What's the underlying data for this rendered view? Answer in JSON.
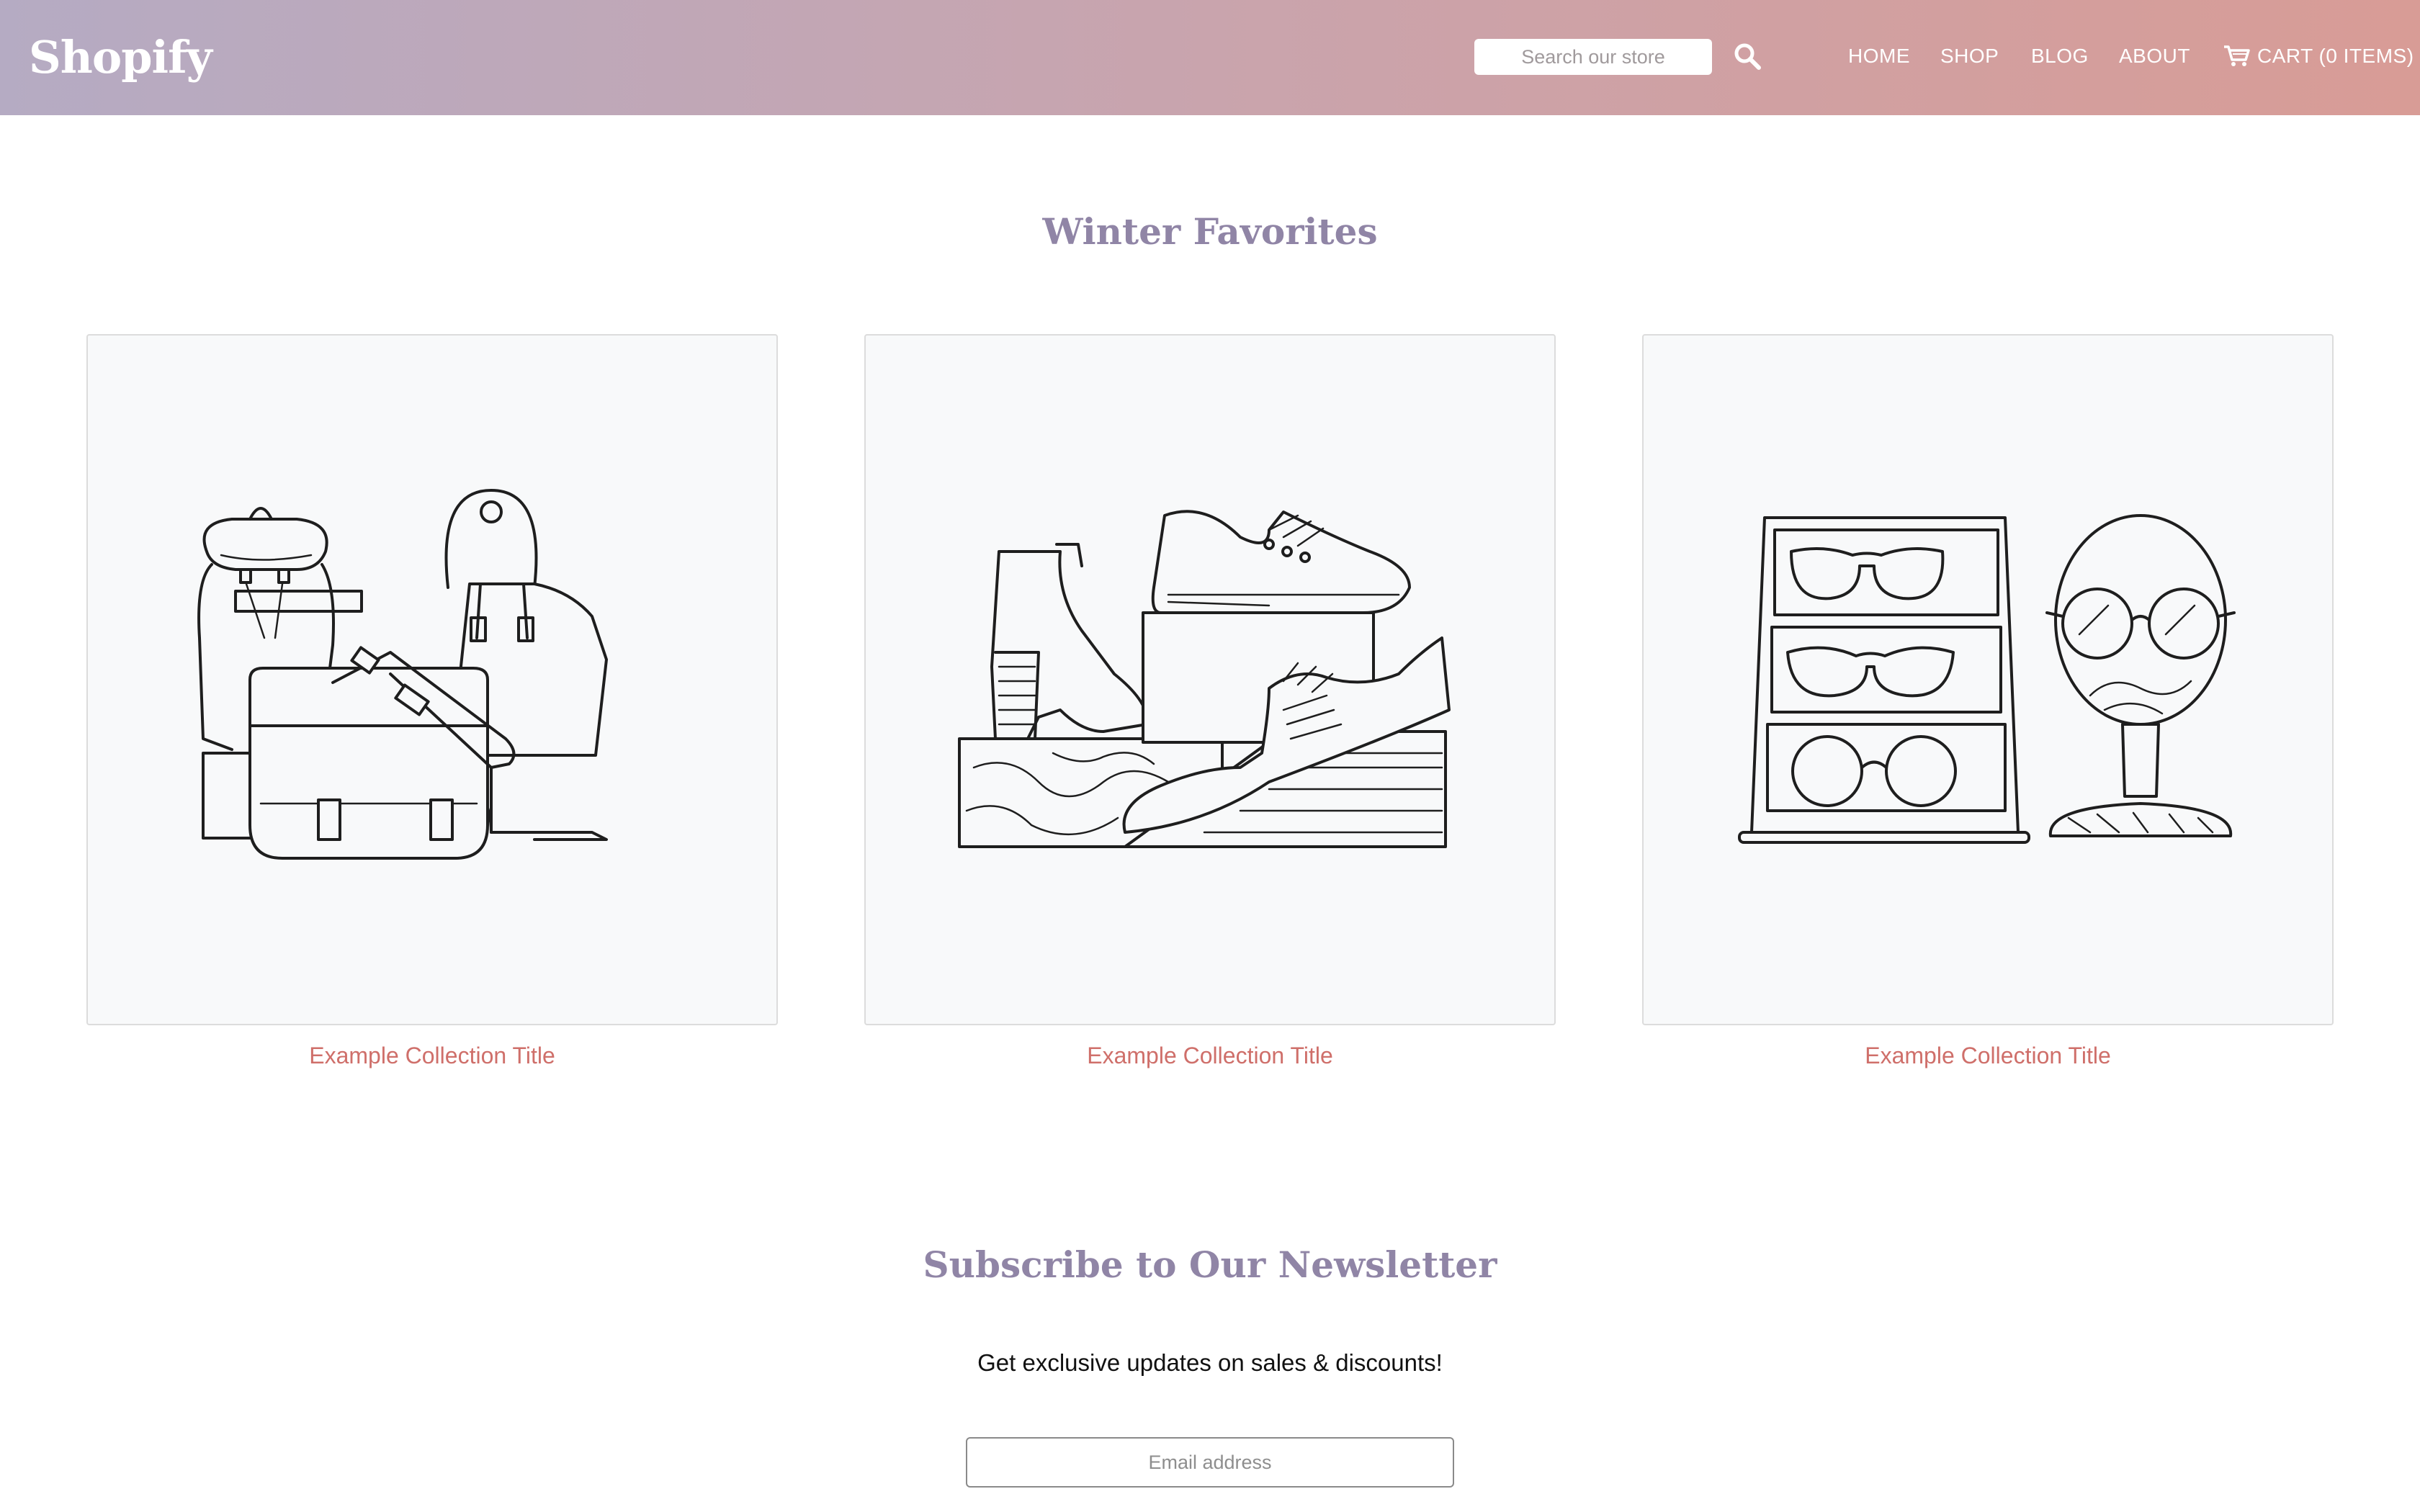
{
  "header": {
    "logo": "Shopify",
    "search_placeholder": "Search our store",
    "nav": [
      {
        "label": "HOME"
      },
      {
        "label": "SHOP"
      },
      {
        "label": "BLOG"
      },
      {
        "label": "ABOUT"
      }
    ],
    "cart_label": "CART (0 ITEMS)",
    "icons": {
      "search": "search-icon",
      "cart": "cart-icon"
    }
  },
  "collections": {
    "title": "Winter Favorites",
    "items": [
      {
        "title": "Example Collection Title",
        "image": "bags-illustration"
      },
      {
        "title": "Example Collection Title",
        "image": "shoes-illustration"
      },
      {
        "title": "Example Collection Title",
        "image": "glasses-illustration"
      }
    ]
  },
  "newsletter": {
    "title": "Subscribe to Our Newsletter",
    "text": "Get exclusive updates on sales & discounts!",
    "email_placeholder": "Email address"
  },
  "colors": {
    "header_gradient_start": "#b5abc3",
    "header_gradient_end": "#d89c96",
    "heading": "#9085a6",
    "link": "#cf6f6a",
    "card_bg": "#f8f9fa"
  }
}
